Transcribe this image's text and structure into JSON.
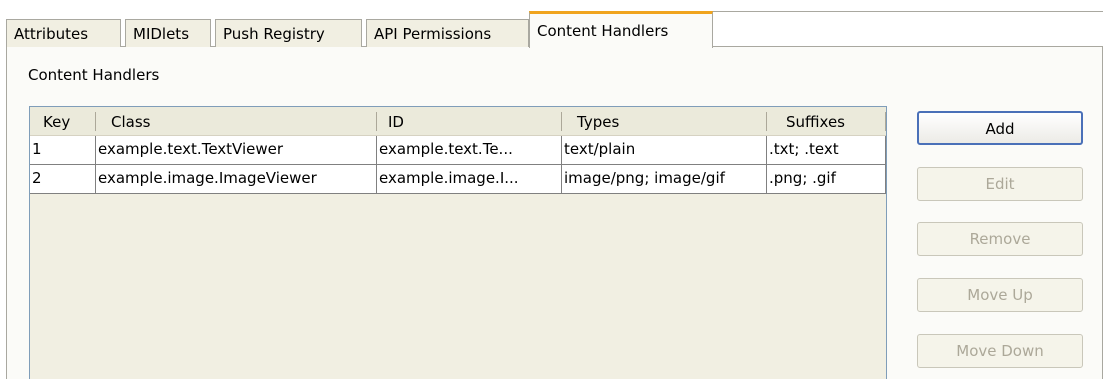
{
  "tabs": [
    {
      "label": "Attributes",
      "active": false
    },
    {
      "label": "MIDlets",
      "active": false
    },
    {
      "label": "Push Registry",
      "active": false
    },
    {
      "label": "API Permissions",
      "active": false
    },
    {
      "label": "Content Handlers",
      "active": true
    }
  ],
  "section_title": "Content Handlers",
  "table": {
    "columns": [
      "Key",
      "Class",
      "ID",
      "Types",
      "Suffixes"
    ],
    "rows": [
      [
        "1",
        "example.text.TextViewer",
        "example.text.Te...",
        "text/plain",
        ".txt; .text"
      ],
      [
        "2",
        "example.image.ImageViewer",
        "example.image.I...",
        "image/png; image/gif",
        ".png; .gif"
      ]
    ]
  },
  "buttons": {
    "add": {
      "label": "Add",
      "enabled": true
    },
    "edit": {
      "label": "Edit",
      "enabled": false
    },
    "remove": {
      "label": "Remove",
      "enabled": false
    },
    "move_up": {
      "label": "Move Up",
      "enabled": false
    },
    "move_down": {
      "label": "Move Down",
      "enabled": false
    }
  },
  "colors": {
    "active_tab_accent": "#f0a41e",
    "panel_background": "#fbfbf8",
    "table_border": "#7f9db9",
    "default_button_border": "#4a70b8"
  }
}
